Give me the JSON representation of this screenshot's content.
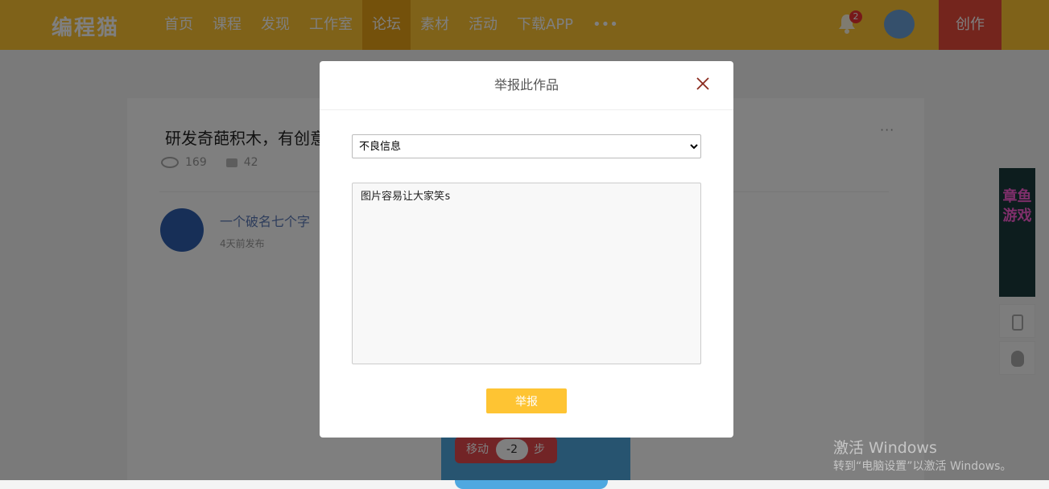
{
  "header": {
    "logo": "编程猫",
    "nav": [
      "首页",
      "课程",
      "发现",
      "工作室",
      "论坛",
      "素材",
      "活动",
      "下载APP",
      "•••"
    ],
    "active_nav": "论坛",
    "notification_count": "2",
    "create_label": "创作"
  },
  "post": {
    "title": "研发奇葩积木，有创意",
    "views": "169",
    "comments": "42",
    "more": "···",
    "author": "一个破名七个字",
    "time": "4天前发布",
    "block_move": "移动",
    "block_move_value": "-2",
    "block_move_unit": "步"
  },
  "side": {
    "ad_text": "章鱼游戏"
  },
  "modal": {
    "title": "举报此作品",
    "selected_reason": "不良信息",
    "detail_value": "图片容易让大家笑s",
    "submit_label": "举报"
  },
  "watermark": {
    "title": "激活 Windows",
    "subtitle": "转到“电脑设置”以激活 Windows。"
  }
}
